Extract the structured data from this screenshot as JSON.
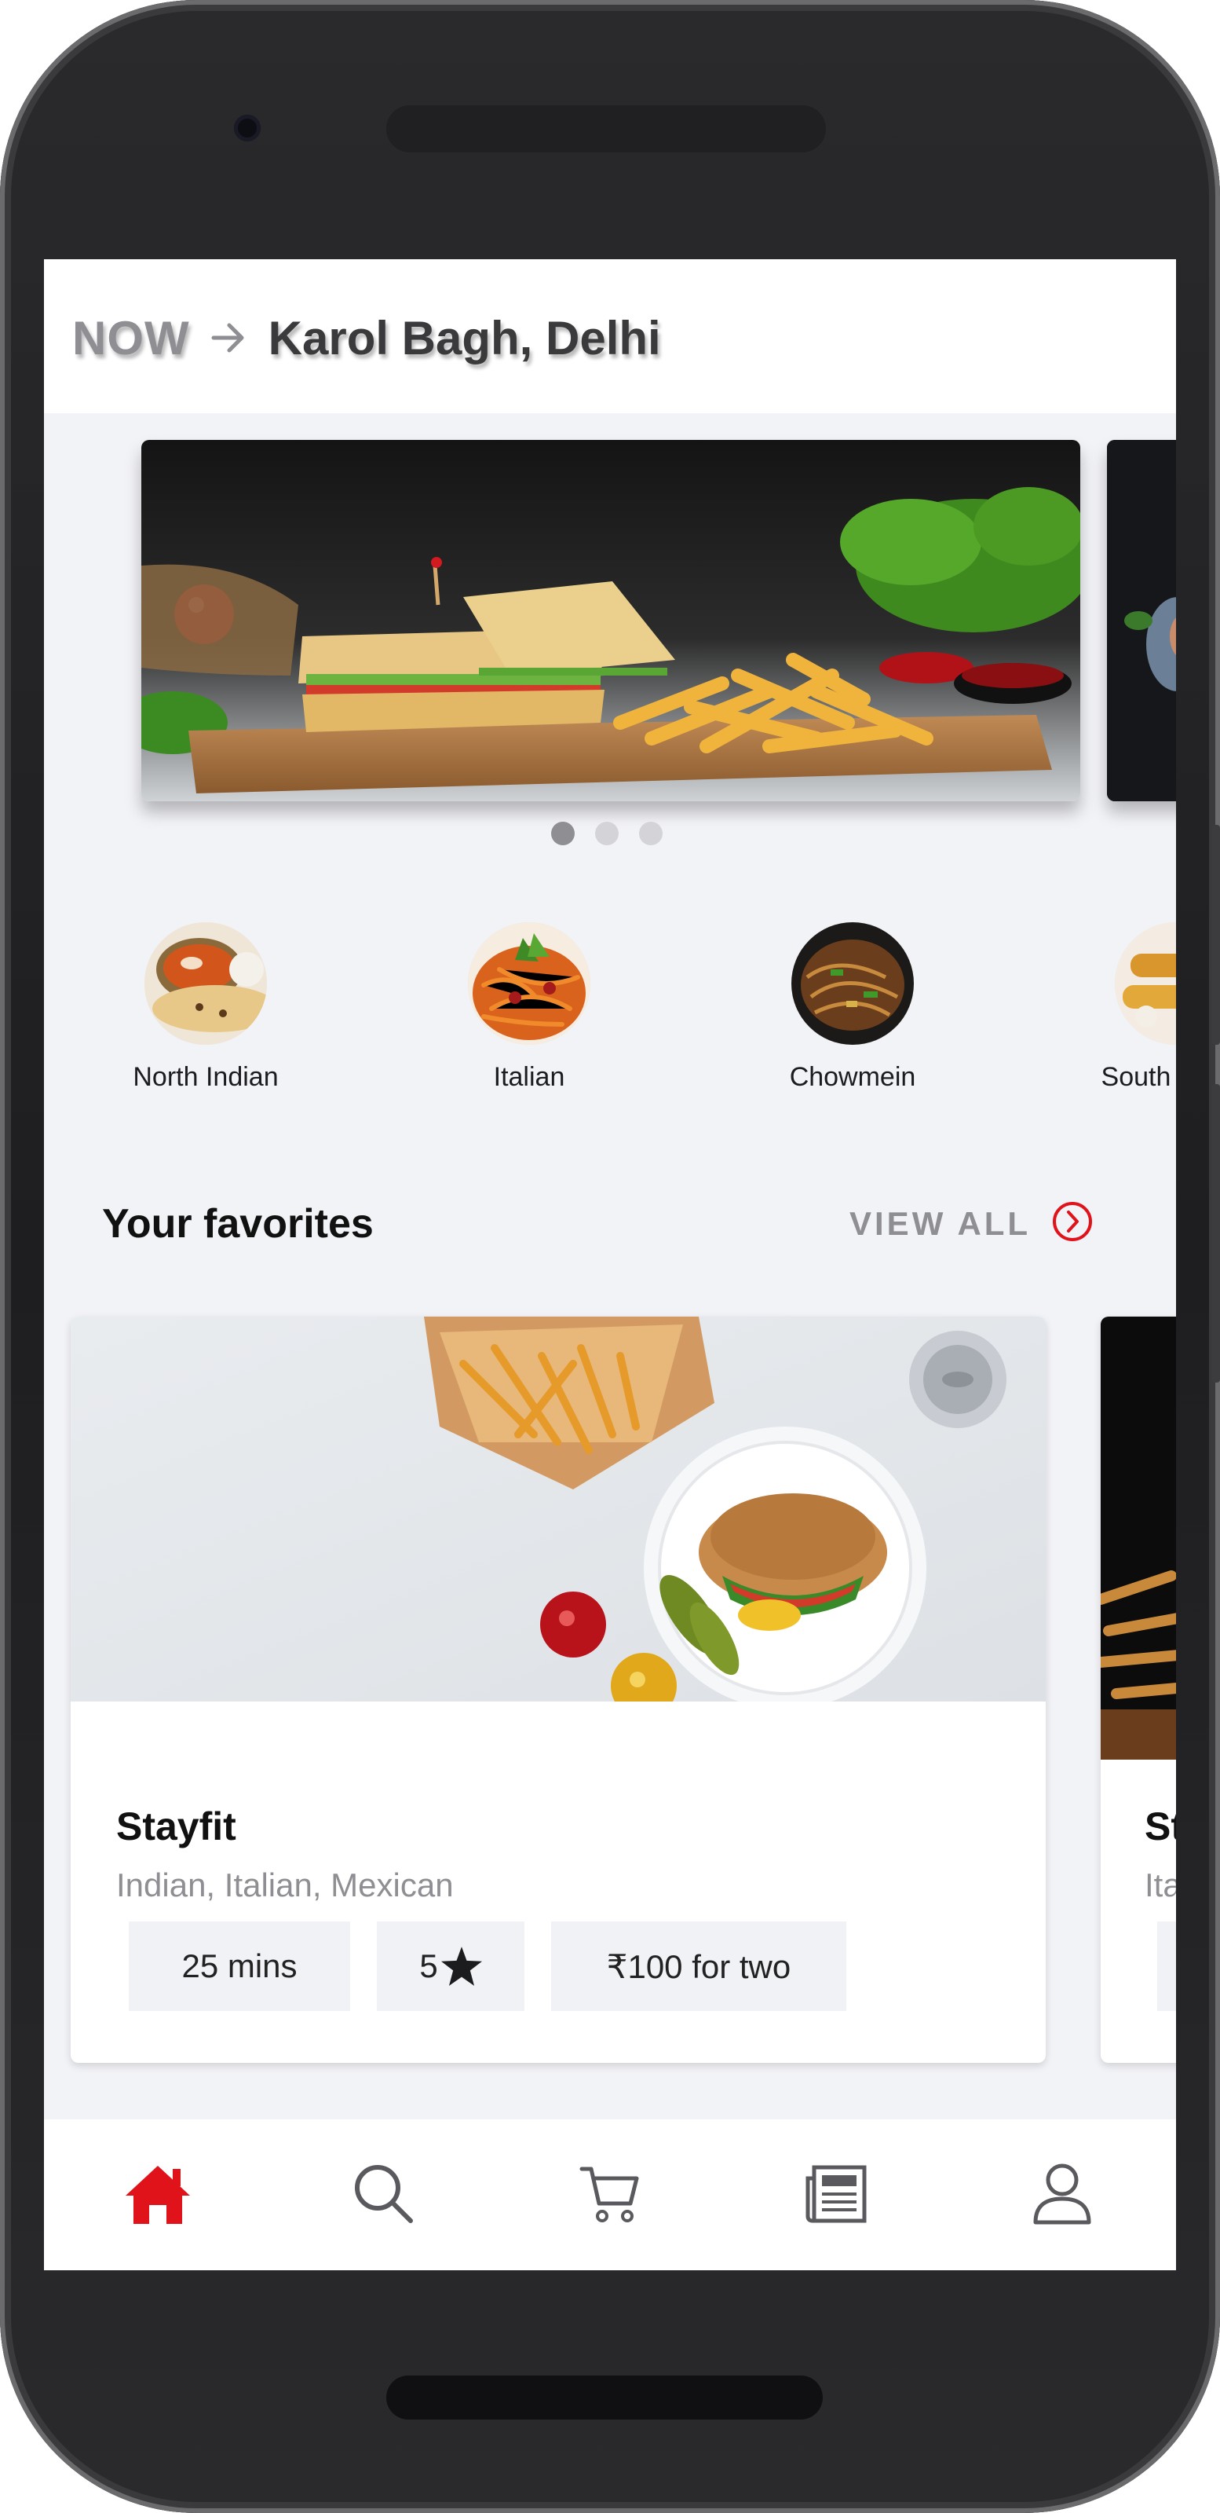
{
  "header": {
    "now_label": "NOW",
    "location": "Karol Bagh, Delhi"
  },
  "carousel": {
    "slide_count": 3,
    "active_index": 0
  },
  "categories": [
    {
      "label": "North Indian"
    },
    {
      "label": "Italian"
    },
    {
      "label": "Chowmein"
    },
    {
      "label": "South Indian"
    }
  ],
  "favorites": {
    "title": "Your favorites",
    "view_all_label": "VIEW ALL",
    "cards": [
      {
        "name": "Stayfit",
        "cuisine": "Indian, Italian, Mexican",
        "time": "25 mins",
        "rating": "5",
        "price": "₹100 for two"
      },
      {
        "name": "Stayfit",
        "cuisine": "Italian"
      }
    ]
  },
  "nav": {
    "active": "home",
    "items": [
      "home",
      "search",
      "cart",
      "news",
      "profile"
    ]
  },
  "colors": {
    "accent": "#e0121a",
    "muted": "#8e8e93",
    "background": "#f2f3f7"
  }
}
